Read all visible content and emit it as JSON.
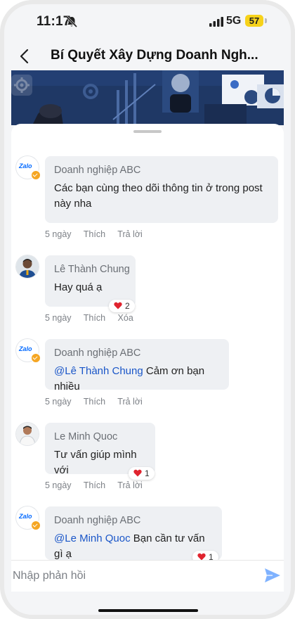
{
  "status_bar": {
    "time": "11:17",
    "network": "5G",
    "battery": "57"
  },
  "header": {
    "title": "Bí Quyết Xây Dựng Doanh Ngh..."
  },
  "icons": {
    "back": "chevron-left-icon",
    "mute": "bell-off-icon",
    "signal": "signal-icon",
    "send": "send-icon",
    "like": "heart-icon"
  },
  "colors": {
    "mention": "#1a56c8",
    "send": "#7fb2ff",
    "verified": "#f5a623",
    "heart": "#e0242f",
    "bubble": "#eef0f3",
    "banner": "#1f3865"
  },
  "comments": [
    {
      "author": "Doanh nghiệp ABC",
      "avatar": "zalo-logo",
      "avatar_text": "Zalo",
      "verified": true,
      "text": "Các bạn cùng theo dõi thông tin ở trong post này nha",
      "time": "5 ngày",
      "actions": [
        "Thích",
        "Trả lời"
      ]
    },
    {
      "author": "Lê Thành Chung",
      "avatar": "user-photo",
      "text": "Hay quá ạ",
      "time": "5 ngày",
      "actions": [
        "Thích",
        "Xóa"
      ],
      "reactions": "2"
    },
    {
      "author": "Doanh nghiệp ABC",
      "avatar": "zalo-logo",
      "avatar_text": "Zalo",
      "verified": true,
      "mention": "@Lê Thành Chung",
      "text": " Cảm ơn bạn nhiều",
      "time": "5 ngày",
      "actions": [
        "Thích",
        "Trả lời"
      ]
    },
    {
      "author": "Le Minh Quoc",
      "avatar": "user-photo",
      "text": "Tư vấn giúp mình với",
      "time": "5 ngày",
      "actions": [
        "Thích",
        "Trả lời"
      ],
      "reactions": "1"
    },
    {
      "author": "Doanh nghiệp ABC",
      "avatar": "zalo-logo",
      "avatar_text": "Zalo",
      "verified": true,
      "mention": "@Le Minh Quoc",
      "text": " Bạn cần tư vấn gì ạ",
      "reactions": "1"
    }
  ],
  "reply": {
    "placeholder": "Nhập phản hồi"
  }
}
